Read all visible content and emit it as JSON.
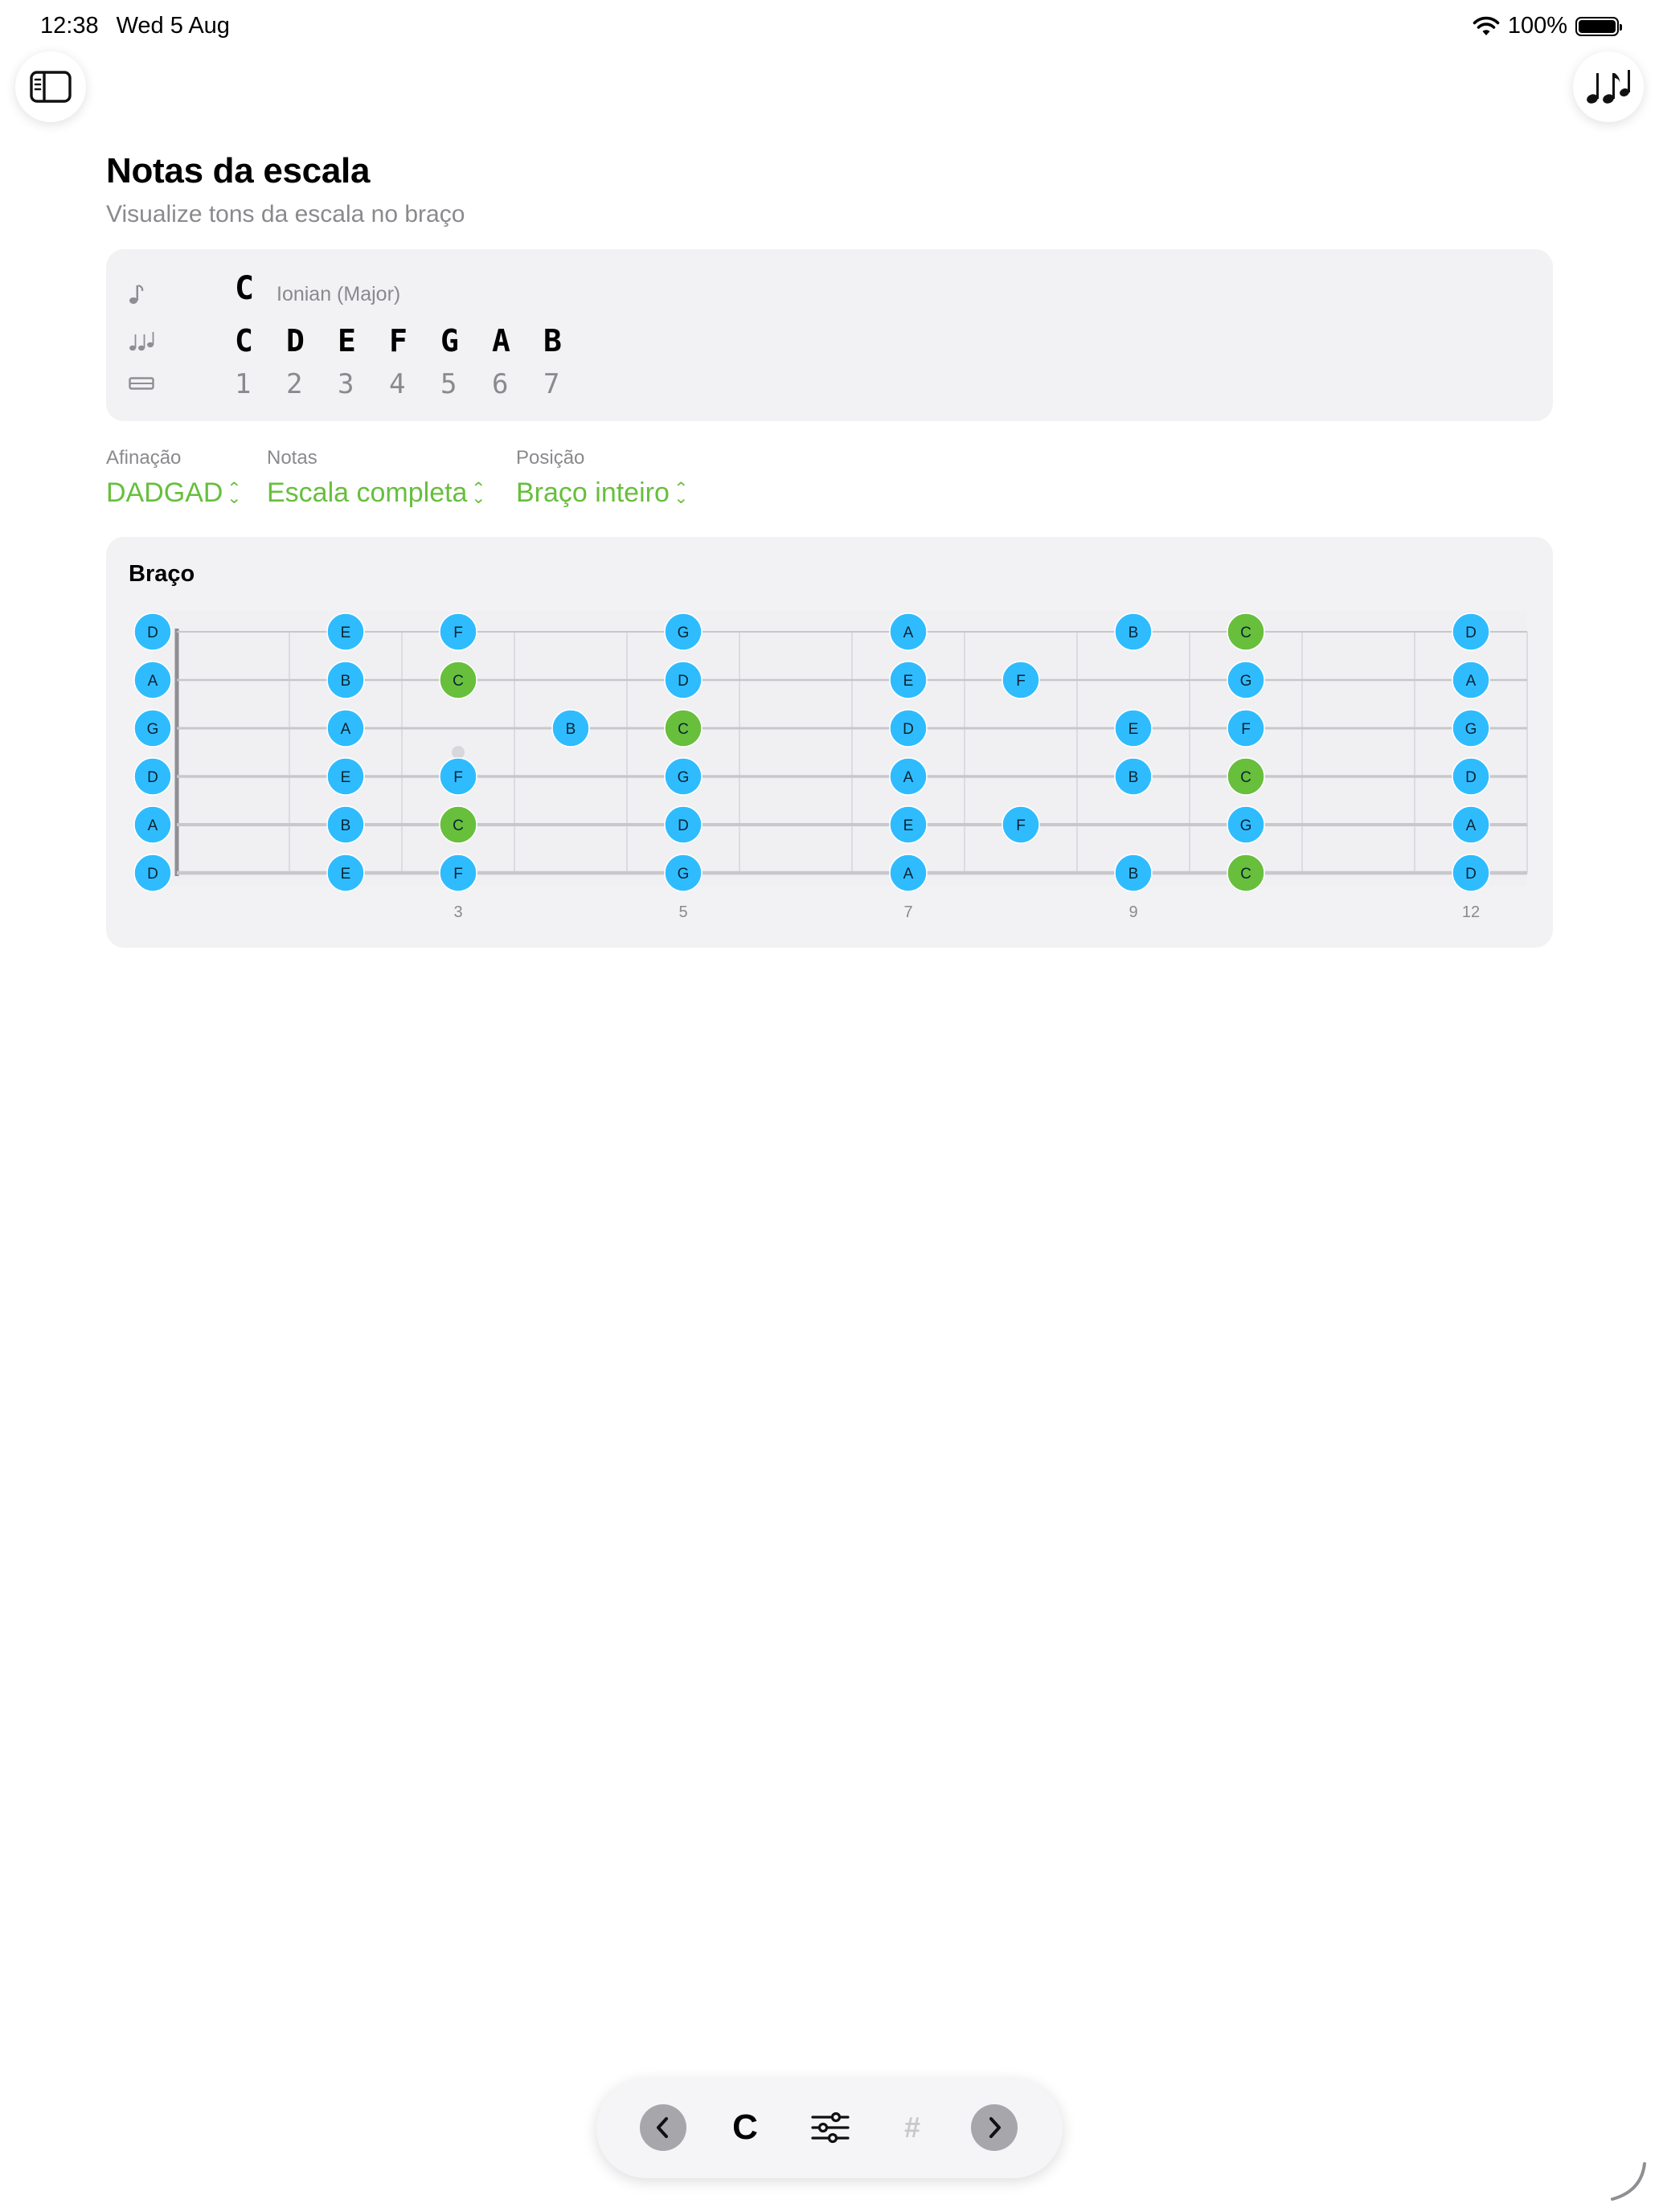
{
  "status_bar": {
    "time": "12:38",
    "date": "Wed 5 Aug",
    "battery": "100%"
  },
  "icons": {
    "sidebar": "sidebar-toggle-icon",
    "notes": "music-notes-icon"
  },
  "header": {
    "title": "Notas da escala",
    "subtitle": "Visualize tons da escala no braço"
  },
  "summary": {
    "root": "C",
    "mode": "Ionian (Major)",
    "notes": [
      "C",
      "D",
      "E",
      "F",
      "G",
      "A",
      "B"
    ],
    "degrees": [
      "1",
      "2",
      "3",
      "4",
      "5",
      "6",
      "7"
    ]
  },
  "pickers": {
    "tuning": {
      "label": "Afinação",
      "value": "DADGAD"
    },
    "notes": {
      "label": "Notas",
      "value": "Escala completa"
    },
    "position": {
      "label": "Posição",
      "value": "Braço inteiro"
    }
  },
  "fretboard": {
    "title": "Braço",
    "fret_markers": [
      3,
      5,
      7,
      9,
      12
    ],
    "root_note": "C",
    "colors": {
      "root": "#67bf3c",
      "note": "#2fbcff",
      "string": "#c7c7cc",
      "fret": "#dcdce0",
      "nut": "#8e8e93"
    },
    "strings": [
      {
        "open": "D",
        "notes": [
          {
            "fret": 0,
            "note": "D"
          },
          {
            "fret": 2,
            "note": "E"
          },
          {
            "fret": 3,
            "note": "F"
          },
          {
            "fret": 5,
            "note": "G"
          },
          {
            "fret": 7,
            "note": "A"
          },
          {
            "fret": 9,
            "note": "B"
          },
          {
            "fret": 10,
            "note": "C"
          },
          {
            "fret": 12,
            "note": "D"
          }
        ]
      },
      {
        "open": "A",
        "notes": [
          {
            "fret": 0,
            "note": "A"
          },
          {
            "fret": 2,
            "note": "B"
          },
          {
            "fret": 3,
            "note": "C"
          },
          {
            "fret": 5,
            "note": "D"
          },
          {
            "fret": 7,
            "note": "E"
          },
          {
            "fret": 8,
            "note": "F"
          },
          {
            "fret": 10,
            "note": "G"
          },
          {
            "fret": 12,
            "note": "A"
          }
        ]
      },
      {
        "open": "G",
        "notes": [
          {
            "fret": 0,
            "note": "G"
          },
          {
            "fret": 2,
            "note": "A"
          },
          {
            "fret": 4,
            "note": "B"
          },
          {
            "fret": 5,
            "note": "C"
          },
          {
            "fret": 7,
            "note": "D"
          },
          {
            "fret": 9,
            "note": "E"
          },
          {
            "fret": 10,
            "note": "F"
          },
          {
            "fret": 12,
            "note": "G"
          }
        ]
      },
      {
        "open": "D",
        "notes": [
          {
            "fret": 0,
            "note": "D"
          },
          {
            "fret": 2,
            "note": "E"
          },
          {
            "fret": 3,
            "note": "F"
          },
          {
            "fret": 5,
            "note": "G"
          },
          {
            "fret": 7,
            "note": "A"
          },
          {
            "fret": 9,
            "note": "B"
          },
          {
            "fret": 10,
            "note": "C"
          },
          {
            "fret": 12,
            "note": "D"
          }
        ]
      },
      {
        "open": "A",
        "notes": [
          {
            "fret": 0,
            "note": "A"
          },
          {
            "fret": 2,
            "note": "B"
          },
          {
            "fret": 3,
            "note": "C"
          },
          {
            "fret": 5,
            "note": "D"
          },
          {
            "fret": 7,
            "note": "E"
          },
          {
            "fret": 8,
            "note": "F"
          },
          {
            "fret": 10,
            "note": "G"
          },
          {
            "fret": 12,
            "note": "A"
          }
        ]
      },
      {
        "open": "D",
        "notes": [
          {
            "fret": 0,
            "note": "D"
          },
          {
            "fret": 2,
            "note": "E"
          },
          {
            "fret": 3,
            "note": "F"
          },
          {
            "fret": 5,
            "note": "G"
          },
          {
            "fret": 7,
            "note": "A"
          },
          {
            "fret": 9,
            "note": "B"
          },
          {
            "fret": 10,
            "note": "C"
          },
          {
            "fret": 12,
            "note": "D"
          }
        ]
      }
    ]
  },
  "toolbar": {
    "key": "C",
    "sharp": "#"
  }
}
